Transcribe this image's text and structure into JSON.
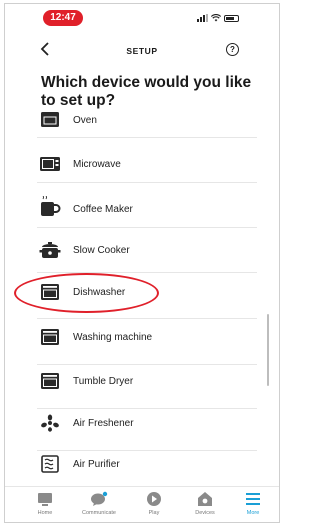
{
  "status_bar": {
    "time": "12:47",
    "accent": "#e0202a"
  },
  "header": {
    "title": "SETUP",
    "back_icon": "chevron-left-icon",
    "help_icon": "question-circle-icon"
  },
  "question": "Which device would you like to set up?",
  "devices": [
    {
      "label": "Oven",
      "icon": "oven-icon"
    },
    {
      "label": "Microwave",
      "icon": "microwave-icon"
    },
    {
      "label": "Coffee Maker",
      "icon": "coffee-maker-icon"
    },
    {
      "label": "Slow Cooker",
      "icon": "slow-cooker-icon"
    },
    {
      "label": "Dishwasher",
      "icon": "dishwasher-icon",
      "highlighted": true
    },
    {
      "label": "Washing machine",
      "icon": "washing-machine-icon"
    },
    {
      "label": "Tumble Dryer",
      "icon": "tumble-dryer-icon"
    },
    {
      "label": "Air Freshener",
      "icon": "air-freshener-icon"
    },
    {
      "label": "Air Purifier",
      "icon": "air-purifier-icon"
    }
  ],
  "bottom_nav": [
    {
      "label": "Home",
      "icon": "home-icon"
    },
    {
      "label": "Communicate",
      "icon": "chat-icon"
    },
    {
      "label": "Play",
      "icon": "play-icon"
    },
    {
      "label": "Devices",
      "icon": "devices-icon"
    },
    {
      "label": "More",
      "icon": "menu-icon",
      "active": true
    }
  ],
  "colors": {
    "active_nav": "#1a9fd6",
    "highlight_ring": "#e0202a"
  }
}
